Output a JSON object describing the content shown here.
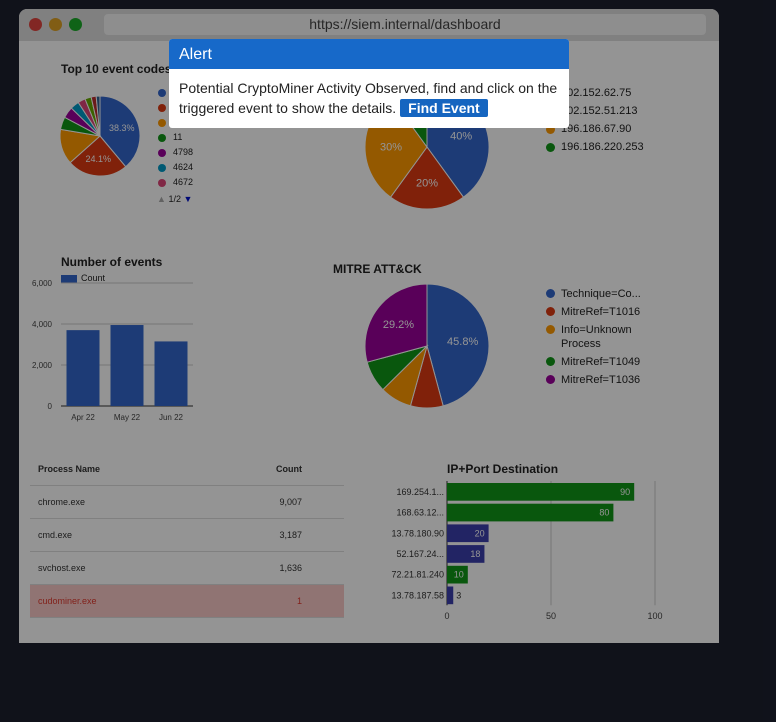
{
  "browser": {
    "url": "https://siem.internal/dashboard",
    "traffic_lights": [
      "#e0443e",
      "#dea123",
      "#1aab29"
    ]
  },
  "event_codes": {
    "title": "Top 10 event codes",
    "slices": [
      {
        "label": "",
        "value": 38.3,
        "color": "#3366cc",
        "display": "38.3%"
      },
      {
        "label": "",
        "value": 24.1,
        "color": "#dc3912",
        "display": "24.1%"
      },
      {
        "label": "",
        "value": 14.0,
        "color": "#ff9900",
        "display": ""
      },
      {
        "label": "",
        "value": 5.0,
        "color": "#109618",
        "display": ""
      },
      {
        "label": "",
        "value": 4.5,
        "color": "#990099",
        "display": ""
      },
      {
        "label": "",
        "value": 3.5,
        "color": "#0099c6",
        "display": ""
      },
      {
        "label": "",
        "value": 3.0,
        "color": "#dd4477",
        "display": ""
      },
      {
        "label": "",
        "value": 2.5,
        "color": "#66aa00",
        "display": ""
      },
      {
        "label": "",
        "value": 2.0,
        "color": "#b82e2e",
        "display": ""
      },
      {
        "label": "",
        "value": 1.5,
        "color": "#316395",
        "display": ""
      }
    ],
    "legend": [
      {
        "label": "",
        "color": "#3366cc"
      },
      {
        "label": "",
        "color": "#dc3912"
      },
      {
        "label": "",
        "color": "#ff9900"
      },
      {
        "label": "11",
        "color": "#109618"
      },
      {
        "label": "4798",
        "color": "#990099"
      },
      {
        "label": "4624",
        "color": "#0099c6"
      },
      {
        "label": "4672",
        "color": "#dd4477"
      }
    ],
    "pager": "1/2"
  },
  "source_ip": {
    "slices": [
      {
        "value": 40,
        "color": "#3366cc",
        "display": "40%"
      },
      {
        "value": 20,
        "color": "#dc3912",
        "display": "20%"
      },
      {
        "value": 30,
        "color": "#ff9900",
        "display": "30%"
      },
      {
        "value": 10,
        "color": "#109618",
        "display": ""
      }
    ],
    "legend": [
      {
        "label": "102.152.62.75",
        "color": "#3366cc"
      },
      {
        "label": "102.152.51.213",
        "color": "#dc3912"
      },
      {
        "label": "196.186.67.90",
        "color": "#ff9900"
      },
      {
        "label": "196.186.220.253",
        "color": "#109618"
      }
    ]
  },
  "mitre": {
    "title": "MITRE ATT&CK",
    "slices": [
      {
        "value": 45.8,
        "color": "#3366cc",
        "display": "45.8%"
      },
      {
        "value": 8.5,
        "color": "#dc3912",
        "display": ""
      },
      {
        "value": 8.3,
        "color": "#ff9900",
        "display": ""
      },
      {
        "value": 8.2,
        "color": "#109618",
        "display": ""
      },
      {
        "value": 29.2,
        "color": "#990099",
        "display": "29.2%"
      }
    ],
    "legend": [
      {
        "label": "Technique=Co...",
        "color": "#3366cc"
      },
      {
        "label": "MitreRef=T1016",
        "color": "#dc3912"
      },
      {
        "label": "Info=Unknown Process",
        "color": "#ff9900"
      },
      {
        "label": "MitreRef=T1049",
        "color": "#109618"
      },
      {
        "label": "MitreRef=T1036",
        "color": "#990099"
      }
    ]
  },
  "chart_data": [
    {
      "type": "bar",
      "title": "Number of events",
      "categories": [
        "Apr 22",
        "May 22",
        "Jun 22"
      ],
      "series": [
        {
          "name": "Count",
          "values": [
            3700,
            3950,
            3150
          ]
        }
      ],
      "yticks": [
        "0",
        "2,000",
        "4,000",
        "6,000"
      ],
      "ylim": [
        0,
        6000
      ],
      "color": "#3366cc"
    },
    {
      "type": "bar",
      "title": "IP+Port Destination",
      "orientation": "horizontal",
      "categories": [
        "169.254.1...",
        "168.63.12...",
        "13.78.180.90",
        "52.167.24...",
        "72.21.81.240",
        "13.78.187.58"
      ],
      "values": [
        90,
        80,
        20,
        18,
        10,
        3
      ],
      "labels": [
        "90",
        "80",
        "20",
        "18",
        "10",
        "3"
      ],
      "colors": [
        "#109618",
        "#109618",
        "#3b3eac",
        "#3b3eac",
        "#109618",
        "#3b3eac"
      ],
      "xticks": [
        "0",
        "50",
        "100"
      ],
      "xlim": [
        0,
        100
      ]
    }
  ],
  "process_table": {
    "headers": [
      "Process Name",
      "Count"
    ],
    "rows": [
      {
        "name": "chrome.exe",
        "count": "9,007"
      },
      {
        "name": "cmd.exe",
        "count": "3,187"
      },
      {
        "name": "svchost.exe",
        "count": "1,636"
      },
      {
        "name": "cudominer.exe",
        "count": "1"
      }
    ]
  },
  "alert": {
    "title": "Alert",
    "message": "Potential CryptoMiner Activity Observed, find and click on the triggered event to show the details.",
    "button": "Find Event"
  }
}
